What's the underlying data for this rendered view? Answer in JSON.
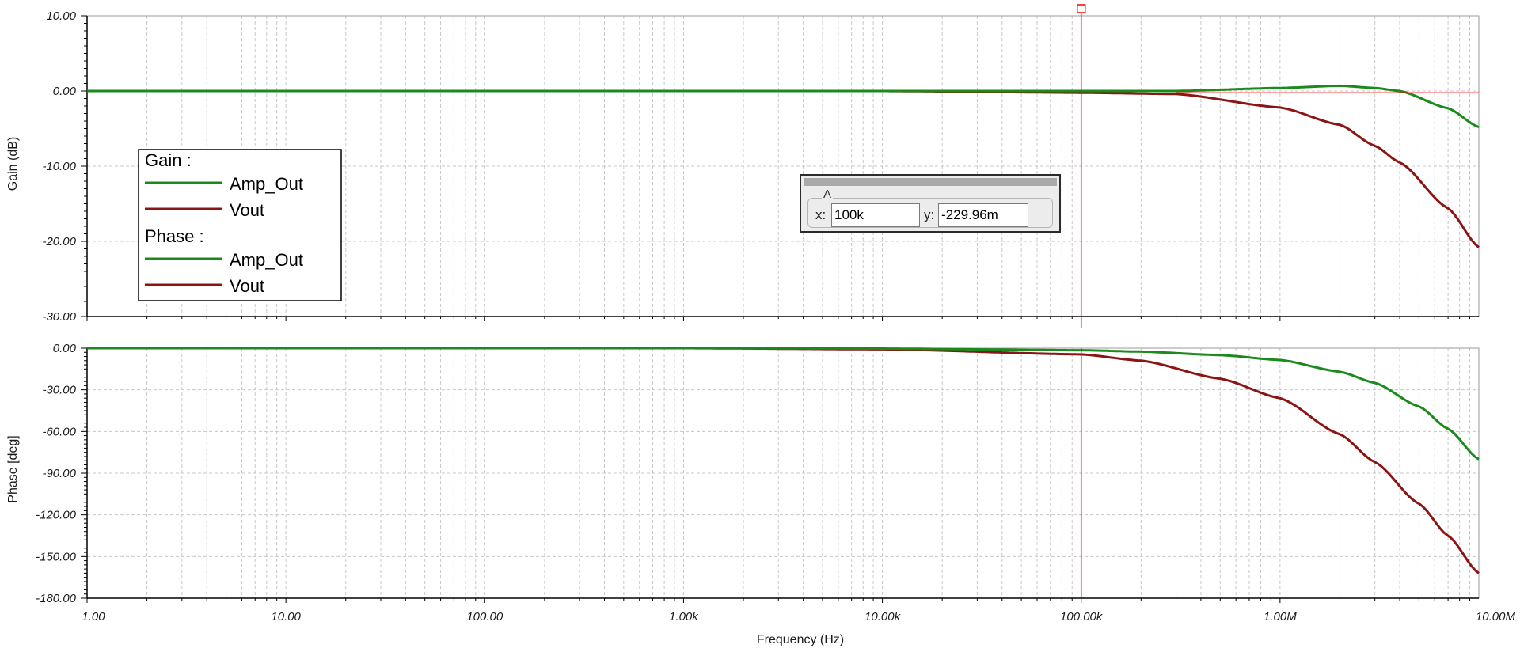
{
  "colors": {
    "amp_out": "#1a8a1a",
    "vout": "#8b1414",
    "cursor": "#ff0000",
    "grid": "#c8c8c8",
    "axis": "#000000"
  },
  "legend": {
    "gain_header": "Gain :",
    "phase_header": "Phase :",
    "gain_items": [
      "Amp_Out",
      "Vout"
    ],
    "phase_items": [
      "Amp_Out",
      "Vout"
    ]
  },
  "cursor_panel": {
    "group_label": "A",
    "x_label": "x:",
    "x_value": "100k",
    "y_label": "y:",
    "y_value": "-229.96m"
  },
  "chart_data": [
    {
      "type": "line",
      "ylabel": "Gain (dB)",
      "xscale": "log",
      "xlim": [
        1,
        10000000
      ],
      "ylim": [
        -30,
        10
      ],
      "yticks": [
        "10.00",
        "0.00",
        "-10.00",
        "-20.00",
        "-30.00"
      ],
      "grid": true,
      "legend_position": "left",
      "cursor_x": 100000,
      "x": [
        1,
        10,
        100,
        1000,
        10000,
        100000,
        300000,
        1000000,
        2000000,
        3000000,
        4000000,
        7000000,
        10000000
      ],
      "series": [
        {
          "name": "Amp_Out",
          "values": [
            0,
            0,
            0,
            0,
            0,
            0,
            0,
            0.4,
            0.7,
            0.4,
            0,
            -2.3,
            -4.8
          ]
        },
        {
          "name": "Vout",
          "values": [
            0,
            0,
            0,
            0,
            0,
            -0.23,
            -0.4,
            -2.2,
            -4.5,
            -7.3,
            -9.5,
            -15.6,
            -20.8
          ]
        }
      ]
    },
    {
      "type": "line",
      "ylabel": "Phase [deg]",
      "xlabel": "Frequency (Hz)",
      "xscale": "log",
      "xlim": [
        1,
        10000000
      ],
      "ylim": [
        -180,
        0
      ],
      "yticks": [
        "0.00",
        "-30.00",
        "-60.00",
        "-90.00",
        "-120.00",
        "-150.00",
        "-180.00"
      ],
      "xticks": [
        "1.00",
        "10.00",
        "100.00",
        "1.00k",
        "10.00k",
        "100.00k",
        "1.00M",
        "10.00M"
      ],
      "grid": true,
      "cursor_x": 100000,
      "x": [
        1,
        10,
        100,
        1000,
        10000,
        100000,
        200000,
        500000,
        1000000,
        2000000,
        3000000,
        5000000,
        7000000,
        10000000
      ],
      "series": [
        {
          "name": "Amp_Out",
          "values": [
            0,
            0,
            0,
            0,
            -0.3,
            -1.5,
            -2.5,
            -5,
            -8.5,
            -17,
            -25,
            -42,
            -58,
            -80
          ]
        },
        {
          "name": "Vout",
          "values": [
            0,
            0,
            0,
            0,
            -0.8,
            -4.5,
            -9,
            -22,
            -36,
            -62,
            -82,
            -112,
            -135,
            -162
          ]
        }
      ]
    }
  ]
}
